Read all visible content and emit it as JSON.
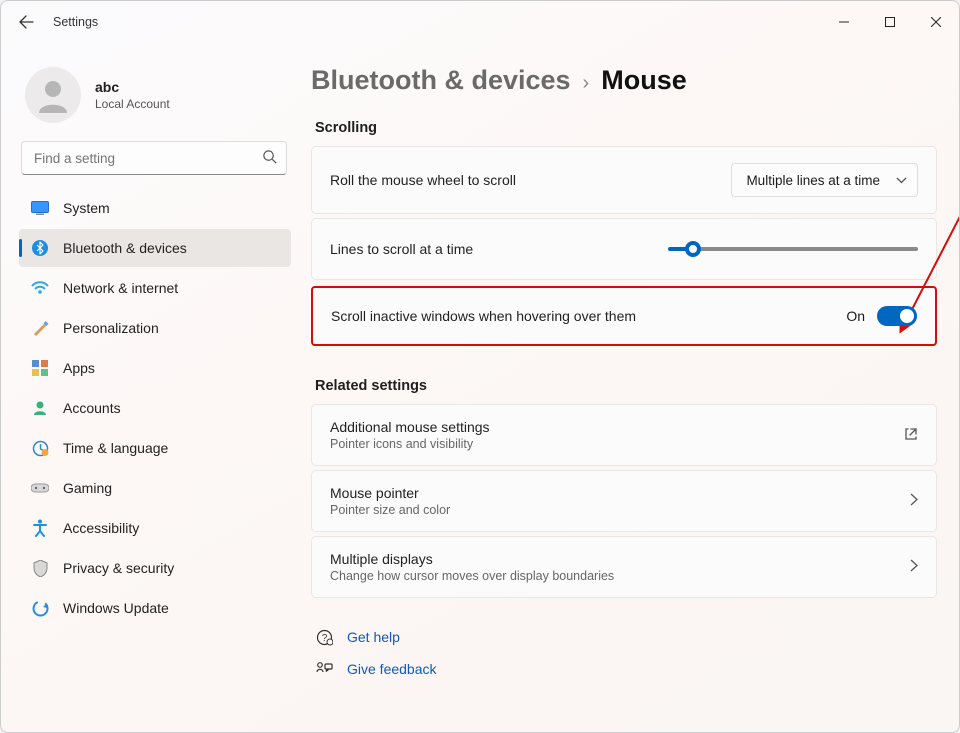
{
  "window": {
    "title": "Settings"
  },
  "user": {
    "name": "abc",
    "account_type": "Local Account"
  },
  "search": {
    "placeholder": "Find a setting"
  },
  "nav": {
    "items": [
      {
        "label": "System"
      },
      {
        "label": "Bluetooth & devices"
      },
      {
        "label": "Network & internet"
      },
      {
        "label": "Personalization"
      },
      {
        "label": "Apps"
      },
      {
        "label": "Accounts"
      },
      {
        "label": "Time & language"
      },
      {
        "label": "Gaming"
      },
      {
        "label": "Accessibility"
      },
      {
        "label": "Privacy & security"
      },
      {
        "label": "Windows Update"
      }
    ]
  },
  "breadcrumb": {
    "parent": "Bluetooth & devices",
    "current": "Mouse"
  },
  "sections": {
    "scrolling": {
      "header": "Scrolling",
      "roll_label": "Roll the mouse wheel to scroll",
      "roll_value": "Multiple lines at a time",
      "lines_label": "Lines to scroll at a time",
      "inactive_label": "Scroll inactive windows when hovering over them",
      "inactive_state": "On"
    },
    "related": {
      "header": "Related settings",
      "items": [
        {
          "title": "Additional mouse settings",
          "sub": "Pointer icons and visibility"
        },
        {
          "title": "Mouse pointer",
          "sub": "Pointer size and color"
        },
        {
          "title": "Multiple displays",
          "sub": "Change how cursor moves over display boundaries"
        }
      ]
    }
  },
  "footer": {
    "help": "Get help",
    "feedback": "Give feedback"
  }
}
